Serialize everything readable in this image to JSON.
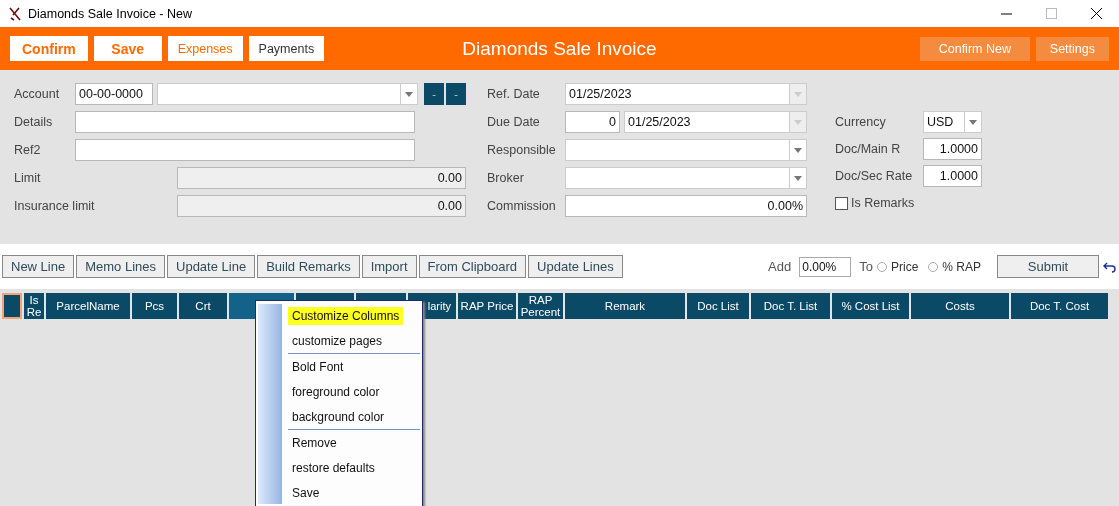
{
  "window": {
    "title": "Diamonds Sale Invoice - New"
  },
  "toolbar": {
    "left_buttons": [
      {
        "label": "Confirm",
        "kind": "primary"
      },
      {
        "label": "Save",
        "kind": "primary"
      },
      {
        "label": "Expenses",
        "kind": "secondary"
      },
      {
        "label": "Payments",
        "kind": "plain"
      }
    ],
    "title": "Diamonds Sale Invoice",
    "right_buttons": [
      "Confirm  New",
      "Settings"
    ]
  },
  "form": {
    "left": [
      {
        "label": "Account",
        "kind": "account",
        "code": "00-00-0000",
        "buttons": [
          "-",
          "-"
        ]
      },
      {
        "label": "Details",
        "kind": "text"
      },
      {
        "label": "Ref2",
        "kind": "text"
      },
      {
        "label": "Limit",
        "kind": "readonly",
        "value": "0.00"
      },
      {
        "label": "Insurance limit",
        "kind": "readonly",
        "value": "0.00"
      }
    ],
    "middle": [
      {
        "label": "Ref. Date",
        "kind": "date",
        "value": "01/25/2023"
      },
      {
        "label": "Due Date",
        "kind": "days_date",
        "days": "0",
        "value": "01/25/2023"
      },
      {
        "label": "Responsible",
        "kind": "combo"
      },
      {
        "label": "Broker",
        "kind": "combo"
      },
      {
        "label": "Commission",
        "kind": "number",
        "value": "0.00%"
      }
    ],
    "right": [
      {
        "label": "Currency",
        "kind": "combo",
        "value": "USD"
      },
      {
        "label": "Doc/Main R",
        "kind": "number",
        "value": "1.0000"
      },
      {
        "label": "Doc/Sec Rate",
        "kind": "number",
        "value": "1.0000"
      },
      {
        "label": "Is Remarks",
        "kind": "checkbox",
        "checked": false
      }
    ]
  },
  "line_buttons": [
    "New Line",
    "Memo Lines",
    "Update Line",
    "Build Remarks",
    "Import",
    "From Clipboard",
    "Update Lines"
  ],
  "add": {
    "label": "Add",
    "value": "0.00%",
    "to_label": "To",
    "options": [
      {
        "label": "Price",
        "selected": false
      },
      {
        "label": "% RAP",
        "selected": false
      }
    ],
    "submit": "Submit"
  },
  "grid": {
    "columns": [
      {
        "label": "Is Re",
        "selected": false
      },
      {
        "label": "ParcelName",
        "selected": false
      },
      {
        "label": "Pcs",
        "selected": false
      },
      {
        "label": "Crt",
        "selected": false
      },
      {
        "selected": true
      },
      {
        "selected": false
      },
      {
        "selected": false
      },
      {
        "label": "larity",
        "selected": false
      },
      {
        "label": "RAP Price",
        "selected": false
      },
      {
        "label": "RAP Percent",
        "selected": false
      },
      {
        "label": "Remark",
        "selected": false
      },
      {
        "label": "Doc List",
        "selected": false
      },
      {
        "label": "Doc T. List",
        "selected": false
      },
      {
        "label": "% Cost List",
        "selected": false
      },
      {
        "label": "Costs",
        "selected": false
      },
      {
        "label": "Doc T. Cost",
        "selected": false
      }
    ]
  },
  "context_menu": {
    "items": [
      {
        "kind": "item",
        "label": "Customize Columns",
        "selected": true
      },
      {
        "kind": "item",
        "label": "customize pages",
        "selected": false
      },
      {
        "kind": "separator"
      },
      {
        "kind": "item",
        "label": "Bold Font",
        "selected": false
      },
      {
        "kind": "item",
        "label": "foreground  color",
        "selected": false
      },
      {
        "kind": "item",
        "label": "background  color",
        "selected": false
      },
      {
        "kind": "separator"
      },
      {
        "kind": "item",
        "label": "Remove",
        "selected": false
      },
      {
        "kind": "item",
        "label": "restore defaults",
        "selected": false
      },
      {
        "kind": "item",
        "label": "Save",
        "selected": false
      }
    ]
  }
}
